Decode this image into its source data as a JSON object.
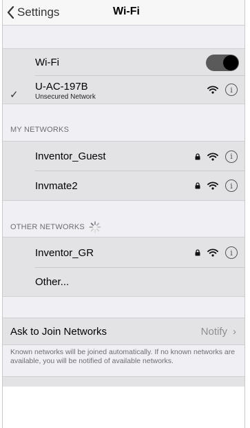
{
  "nav": {
    "back_label": "Settings",
    "title": "Wi-Fi"
  },
  "wifi_toggle": {
    "label": "Wi-Fi",
    "on": true
  },
  "connected_network": {
    "name": "U-AC-197B",
    "subtitle": "Unsecured Network",
    "secured": false
  },
  "my_networks": {
    "header": "MY NETWORKS",
    "items": [
      {
        "name": "Inventor_Guest",
        "secured": true
      },
      {
        "name": "Invmate2",
        "secured": true
      }
    ]
  },
  "other_networks": {
    "header": "OTHER NETWORKS",
    "items": [
      {
        "name": "Inventor_GR",
        "secured": true
      }
    ],
    "other_label": "Other..."
  },
  "ask_to_join": {
    "label": "Ask to Join Networks",
    "value": "Notify",
    "footnote": "Known networks will be joined automatically. If no known networks are available, you will be notified of available networks."
  },
  "icons": {
    "back": "chevron-left-icon",
    "check": "checkmark-icon",
    "lock": "lock-icon",
    "wifi": "wifi-icon",
    "info": "info-icon",
    "spinner": "spinner-icon",
    "disclosure": "chevron-right-icon"
  },
  "colors": {
    "toggle_on": "#5a5a5a",
    "background": "#efeff4",
    "group": "#e3e3e6",
    "secondary_text": "#8e8e93"
  }
}
